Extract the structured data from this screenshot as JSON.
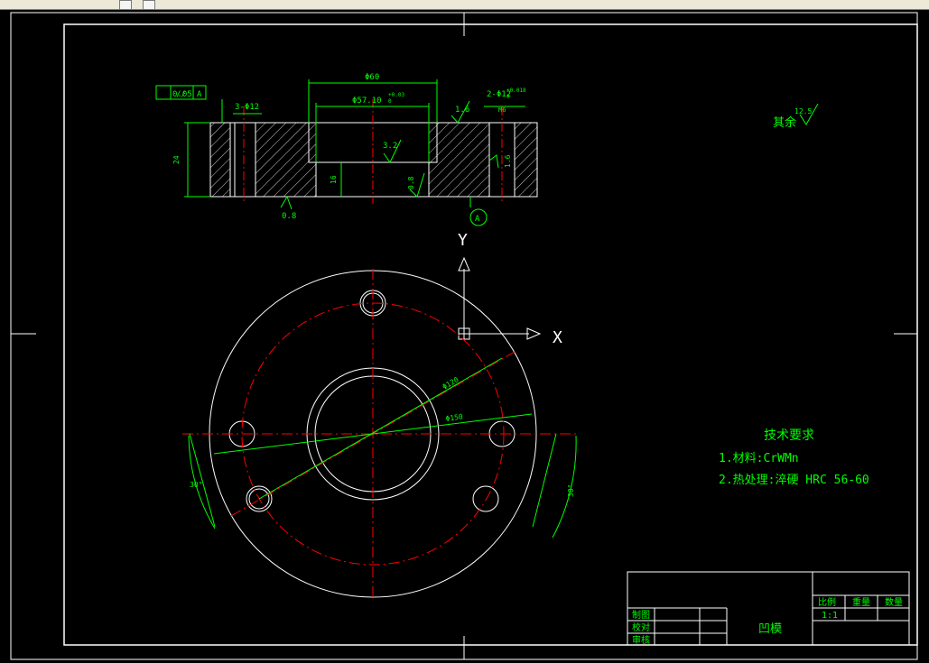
{
  "window": {
    "toolbar_icons": [
      "tool-icon",
      "refresh-icon"
    ]
  },
  "drawing": {
    "flatness": {
      "symbol": "//",
      "tolerance": "0.05",
      "datum": "A"
    },
    "dims": {
      "holes": "3-Φ12",
      "outer_top": "Φ60",
      "inner_top": "Φ57.10",
      "inner_tol_upper": "+0.03",
      "inner_tol_lower": "0",
      "pin_holes": "2-Φ12",
      "pin_tol_upper": "+0.018",
      "pin_tol_lower": "0",
      "pin_depth": "M6",
      "height": "24",
      "depth": "16",
      "pcd": "Φ120",
      "bore": "Φ150",
      "angle_left": "30°",
      "angle_right": "30°"
    },
    "roughness": {
      "r1": "1.6",
      "r2": "3.2",
      "r3": "0.8",
      "r4": "1.6",
      "r5": "0.8",
      "rest_label": "其余",
      "rest_value": "12.5"
    },
    "datum_marker": "A",
    "axes": {
      "x": "X",
      "y": "Y"
    },
    "tech_req": {
      "title": "技术要求",
      "item1": "1.材料:CrWMn",
      "item2": "2.热处理:淬硬 HRC 56-60"
    },
    "title_block": {
      "scale_header": "比例",
      "weight_header": "重量",
      "qty_header": "数量",
      "scale_value": "1:1",
      "role1": "制图",
      "role2": "校对",
      "role3": "审核",
      "part_name": "凹模"
    },
    "colors": {
      "background": "#000000",
      "line": "#ffffff",
      "dimension": "#00ff00",
      "centerline": "#ff0000"
    }
  }
}
